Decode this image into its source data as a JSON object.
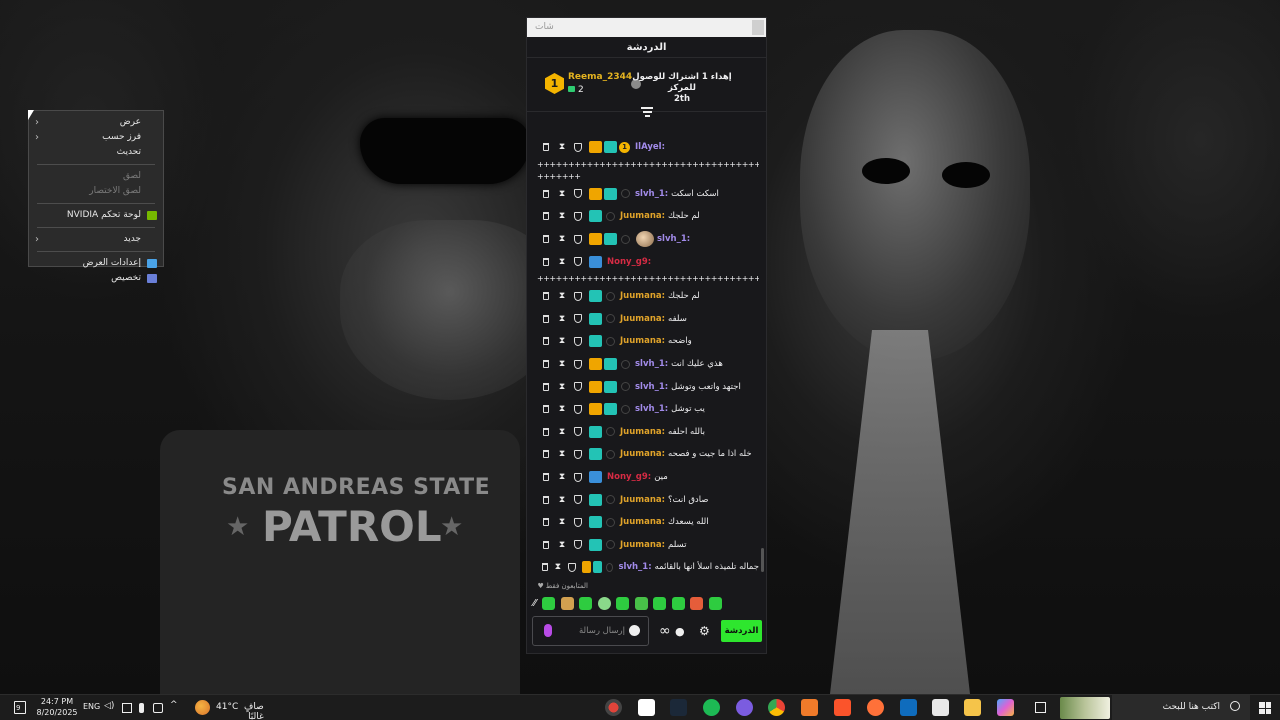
{
  "wallpaper": {
    "patch_line1": "SAN ANDREAS STATE",
    "patch_line2": "PATROL"
  },
  "context_menu": {
    "items": [
      {
        "label": "عرض",
        "has_submenu": true,
        "disabled": false
      },
      {
        "label": "فرز حسب",
        "has_submenu": true,
        "disabled": false
      },
      {
        "label": "تحديث",
        "has_submenu": false,
        "disabled": false
      },
      {
        "label": "لصق",
        "has_submenu": false,
        "disabled": true
      },
      {
        "label": "لصق الاختصار",
        "has_submenu": false,
        "disabled": true
      },
      {
        "label": "لوحة تحكم NVIDIA",
        "has_submenu": false,
        "disabled": false,
        "icon": "nvidia-icon"
      },
      {
        "label": "جديد",
        "has_submenu": true,
        "disabled": false
      },
      {
        "label": "إعدادات العرض",
        "has_submenu": false,
        "disabled": false,
        "icon": "display-icon"
      },
      {
        "label": "تخصيص",
        "has_submenu": false,
        "disabled": false,
        "icon": "personalize-icon"
      }
    ]
  },
  "chat": {
    "window_title": "شات",
    "header_title": "الدردشة",
    "leaderboard": {
      "rank": "1",
      "username": "Reema_2344",
      "gift_count": "2",
      "info_line1": "إهداء 1 اشتراك للوصول للمركز",
      "info_line2": "2th"
    },
    "messages": [
      {
        "type": "msg",
        "badges": [
          "crown",
          "teal",
          "rank1"
        ],
        "username": "IlAyel:",
        "name_color": "purple",
        "text": ""
      },
      {
        "type": "wrap",
        "text": "+++++++++++++++++++++++++++++++++++++++++++++++++++++++++++++"
      },
      {
        "type": "wrap",
        "text": "+++++++"
      },
      {
        "type": "msg",
        "badges": [
          "crown",
          "teal",
          "sub"
        ],
        "username": "slvh_1:",
        "name_color": "purple",
        "text": "اسكت اسكت"
      },
      {
        "type": "msg",
        "badges": [
          "teal",
          "sub"
        ],
        "username": "Juumana:",
        "name_color": "orange",
        "text": "لم حلجك"
      },
      {
        "type": "msg",
        "badges": [
          "crown",
          "teal",
          "sub"
        ],
        "username": "slvh_1:",
        "name_color": "purple",
        "text": "",
        "emote": true
      },
      {
        "type": "msg",
        "badges": [
          "blue"
        ],
        "username": "Nony_g9:",
        "name_color": "red",
        "text": ""
      },
      {
        "type": "wrap",
        "text": "+++++++++++++++++++++++++++++++++++++++++++++++++++"
      },
      {
        "type": "msg",
        "badges": [
          "teal",
          "sub"
        ],
        "username": "Juumana:",
        "name_color": "orange",
        "text": "لم حلجك"
      },
      {
        "type": "msg",
        "badges": [
          "teal",
          "sub"
        ],
        "username": "Juumana:",
        "name_color": "orange",
        "text": "سلفه"
      },
      {
        "type": "msg",
        "badges": [
          "teal",
          "sub"
        ],
        "username": "Juumana:",
        "name_color": "orange",
        "text": "واضحه"
      },
      {
        "type": "msg",
        "badges": [
          "crown",
          "teal",
          "sub"
        ],
        "username": "slvh_1:",
        "name_color": "purple",
        "text": "هذي عليك انت"
      },
      {
        "type": "msg",
        "badges": [
          "crown",
          "teal",
          "sub"
        ],
        "username": "slvh_1:",
        "name_color": "purple",
        "text": "اجتهد واتعب وتوشل"
      },
      {
        "type": "msg",
        "badges": [
          "crown",
          "teal",
          "sub"
        ],
        "username": "slvh_1:",
        "name_color": "purple",
        "text": "يب توشل"
      },
      {
        "type": "msg",
        "badges": [
          "teal",
          "sub"
        ],
        "username": "Juumana:",
        "name_color": "orange",
        "text": "بالله احلفه"
      },
      {
        "type": "msg",
        "badges": [
          "teal",
          "sub"
        ],
        "username": "Juumana:",
        "name_color": "orange",
        "text": "خله اذا ما جيت و فصحه"
      },
      {
        "type": "msg",
        "badges": [
          "blue"
        ],
        "username": "Nony_g9:",
        "name_color": "red",
        "text": "مين"
      },
      {
        "type": "msg",
        "badges": [
          "teal",
          "sub"
        ],
        "username": "Juumana:",
        "name_color": "orange",
        "text": "صادق انت؟"
      },
      {
        "type": "msg",
        "badges": [
          "teal",
          "sub"
        ],
        "username": "Juumana:",
        "name_color": "orange",
        "text": "الله يسعدك"
      },
      {
        "type": "msg",
        "badges": [
          "teal",
          "sub"
        ],
        "username": "Juumana:",
        "name_color": "orange",
        "text": "تسلم"
      },
      {
        "type": "msg",
        "badges": [
          "crown",
          "teal",
          "sub"
        ],
        "username": "slvh_1:",
        "name_color": "purple",
        "text": "جماله تلميذه اسلأ انها بالقائمه"
      }
    ],
    "followers_only": "المتابعون فقط",
    "input_placeholder": "إرسال رسالة",
    "chat_button": "الدردشة"
  },
  "taskbar": {
    "time": "24:7 PM",
    "date": "8/20/2025",
    "language": "ENG",
    "temperature": "41°C",
    "weather": "صافٍ غالبًا",
    "search_placeholder": "اكتب هنا للبحث",
    "notification_count": "9"
  },
  "colors": {
    "chat_bg": "#18181b",
    "chat_button": "#2ee62e",
    "name_orange": "#e0a32a",
    "name_purple": "#a28bea",
    "name_red": "#d62b44",
    "badge_crown": "#f0a500",
    "badge_teal": "#23c3b5"
  }
}
